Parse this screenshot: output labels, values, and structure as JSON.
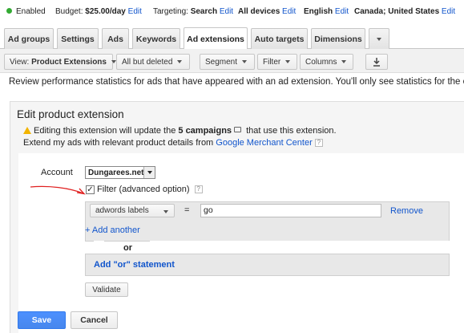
{
  "status": {
    "state": "Enabled",
    "budget_label": "Budget:",
    "budget_value": "$25.00/day",
    "targeting_label": "Targeting:",
    "targeting_value": "Search",
    "devices": "All devices",
    "language": "English",
    "locations": "Canada; United States",
    "edit": "Edit"
  },
  "tabs": [
    "Ad groups",
    "Settings",
    "Ads",
    "Keywords",
    "Ad extensions",
    "Auto targets",
    "Dimensions"
  ],
  "toolbar": {
    "view_prefix": "View:",
    "view_value": "Product Extensions",
    "filter_state": "All but deleted",
    "segment": "Segment",
    "filter": "Filter",
    "columns": "Columns",
    "download_icon": "download-icon"
  },
  "info_text": "Review performance statistics for ads that have appeared with an ad extension. You'll only see statistics for the cam",
  "panel": {
    "title": "Edit product extension",
    "warning_prefix": "Editing this extension will update the ",
    "warning_bold": "5 campaigns",
    "warning_suffix": " that use this extension.",
    "extend_text": "Extend my ads with relevant product details from ",
    "merchant_link": "Google Merchant Center",
    "help": "?"
  },
  "form": {
    "account_label": "Account",
    "account_value": "Dungarees.net",
    "filter_label": "Filter (advanced option)",
    "filter_checked": true,
    "attribute": "adwords labels",
    "operator": "=",
    "value": "go",
    "remove": "Remove",
    "add_another": "+ Add another",
    "or": "or",
    "add_or": "Add \"or\" statement",
    "validate": "Validate"
  },
  "actions": {
    "save": "Save",
    "cancel": "Cancel"
  },
  "colors": {
    "accent": "#4d90fe",
    "link": "#15c",
    "annotation": "#e02020"
  }
}
